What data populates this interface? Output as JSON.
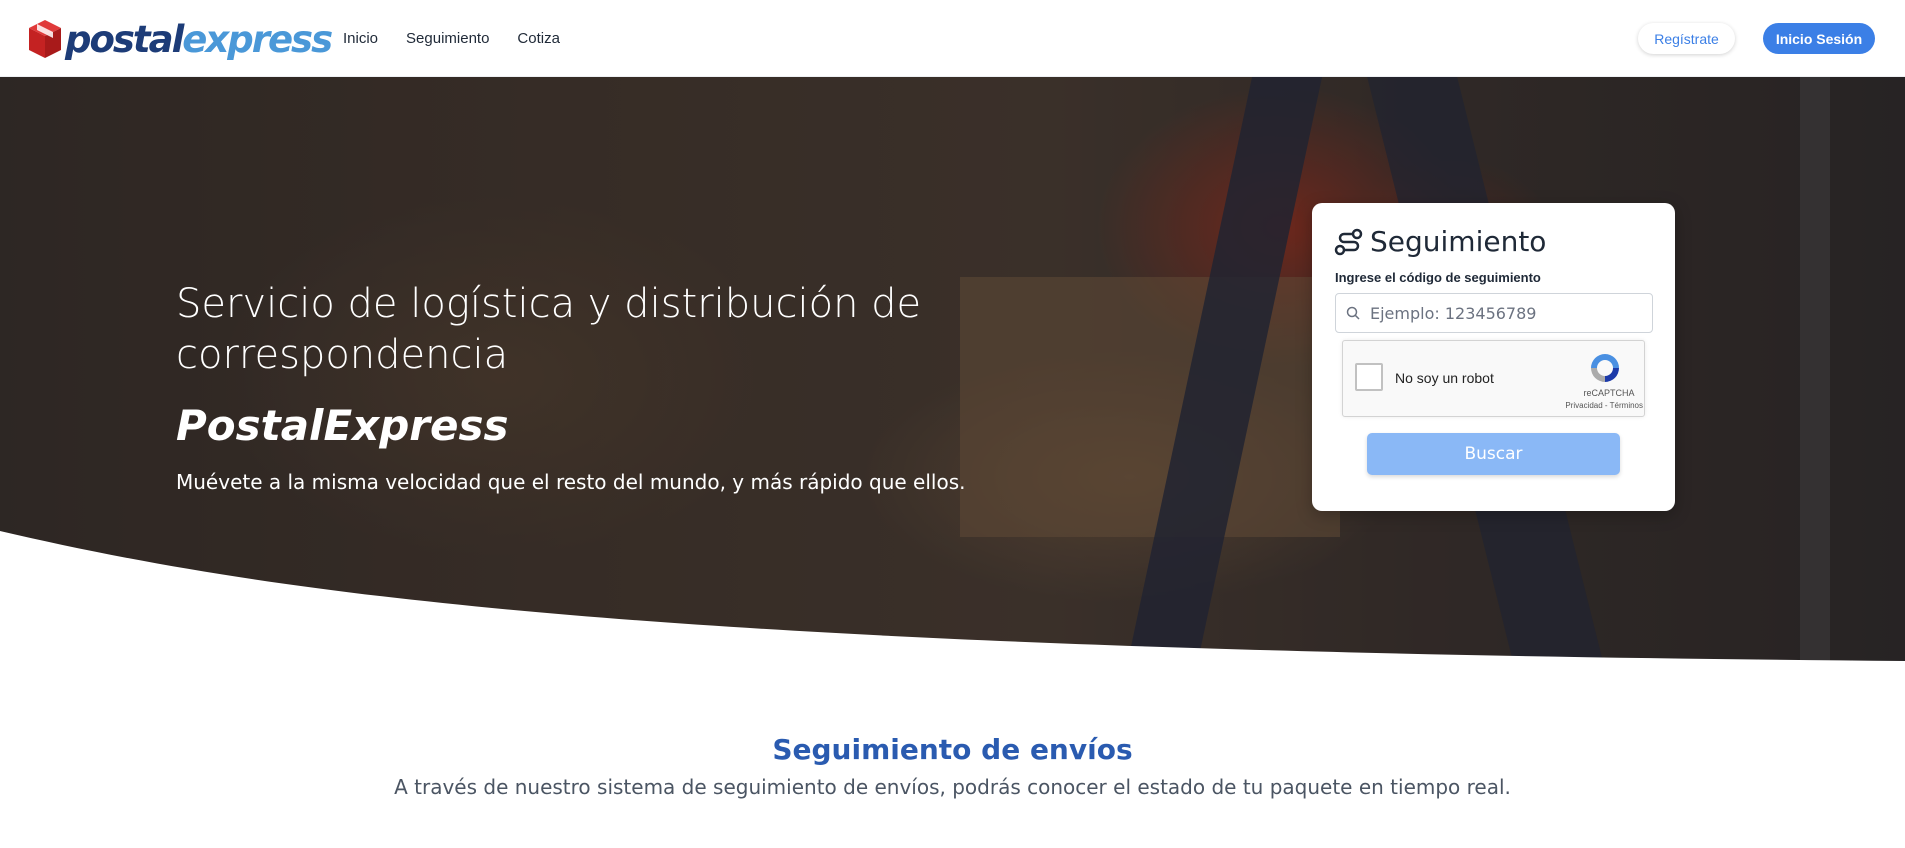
{
  "header": {
    "logo": {
      "part1": "postal",
      "part2": "express",
      "icon": "package-box-icon"
    },
    "nav": [
      {
        "label": "Inicio"
      },
      {
        "label": "Seguimiento"
      },
      {
        "label": "Cotiza"
      }
    ],
    "register_label": "Regístrate",
    "login_label": "Inicio Sesión"
  },
  "hero": {
    "title": "Servicio de logística y distribución de correspondencia",
    "brand": "PostalExpress",
    "subtitle": "Muévete a la misma velocidad que el resto del mundo, y más rápido que ellos."
  },
  "tracking_card": {
    "icon": "route-icon",
    "title": "Seguimiento",
    "label": "Ingrese el código de seguimiento",
    "placeholder": "Ejemplo: 123456789",
    "captcha": {
      "label": "No soy un robot",
      "brand": "reCAPTCHA",
      "links": "Privacidad - Términos"
    },
    "search_label": "Buscar"
  },
  "section": {
    "title": "Seguimiento de envíos",
    "subtitle": "A través de nuestro sistema de seguimiento de envíos, podrás conocer el estado de tu paquete en tiempo real."
  },
  "colors": {
    "primary": "#3b7fe6",
    "primary_disabled": "#8ab8f6",
    "logo_dark": "#1d3c78",
    "logo_light": "#4a98d8",
    "logo_red": "#d32a2a",
    "section_title": "#2a5bb0"
  }
}
